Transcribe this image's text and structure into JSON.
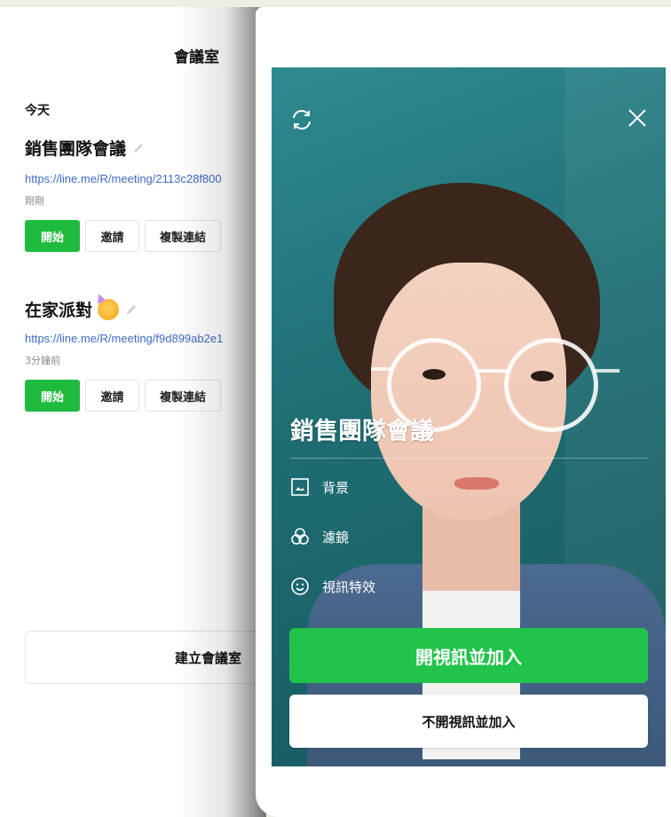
{
  "meeting_list": {
    "title": "會議室",
    "section_today": "今天",
    "meetings": [
      {
        "name": "銷售團隊會議",
        "link": "https://line.me/R/meeting/2113c28f800",
        "time": "剛剛",
        "start_label": "開始",
        "invite_label": "邀請",
        "copy_label": "複製連結"
      },
      {
        "name": "在家派對",
        "link": "https://line.me/R/meeting/f9d899ab2e1",
        "time": "3分鐘前",
        "start_label": "開始",
        "invite_label": "邀請",
        "copy_label": "複製連結"
      }
    ],
    "create_label": "建立會議室"
  },
  "preview": {
    "meeting_name": "銷售團隊會議",
    "options": [
      {
        "icon": "image-icon",
        "label": "背景"
      },
      {
        "icon": "filter-icon",
        "label": "濾鏡"
      },
      {
        "icon": "smiley-effect-icon",
        "label": "視訊特效"
      }
    ],
    "join_video_label": "開視訊並加入",
    "join_no_video_label": "不開視訊並加入"
  },
  "colors": {
    "accent_green": "#1fbb3f",
    "link_blue": "#3d6bc4"
  }
}
